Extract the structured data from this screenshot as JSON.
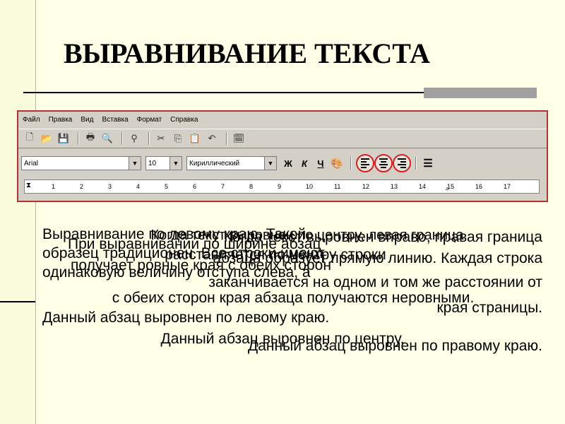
{
  "slide": {
    "title": "ВЫРАВНИВАНИЕ ТЕКСТА"
  },
  "app": {
    "menu": [
      "Файл",
      "Правка",
      "Вид",
      "Вставка",
      "Формат",
      "Справка"
    ],
    "font_name": "Arial",
    "font_size": "10",
    "charset": "Кириллический",
    "bold": "Ж",
    "italic": "К",
    "underline": "Ч",
    "ruler_labels": [
      "1",
      "2",
      "3",
      "4",
      "5",
      "6",
      "7",
      "8",
      "9",
      "10",
      "11",
      "12",
      "13",
      "14",
      "15",
      "16",
      "17"
    ]
  },
  "text_blocks": {
    "left": {
      "lines": [
        "Выравнивание по левому краю. Такой",
        "образец традиционен. Все строки имеют",
        "одинаковую величину отступа слева, а",
        "Данный абзац выровнен по левому краю."
      ]
    },
    "center": {
      "lines": [
        "Когда текст выровнен по центру, левая граница",
        "расставляется по центру строки",
        "с обеих сторон края абзаца получаются неровными.",
        "Данный абзац выровнен по центру."
      ]
    },
    "right": {
      "lines": [
        "Когда текст выровнен вправо, правая граница",
        "абзаца образует прямую линию. Каждая строка",
        "заканчивается на одном и том же расстоянии от",
        "края страницы.",
        "Данный абзац выровнен по правому краю."
      ]
    },
    "justify": {
      "lines": [
        "При выравнивании по ширине абзац",
        "получает ровные края с обеих сторон",
        "обеих сторон края абзаца получаются неровными."
      ]
    }
  }
}
